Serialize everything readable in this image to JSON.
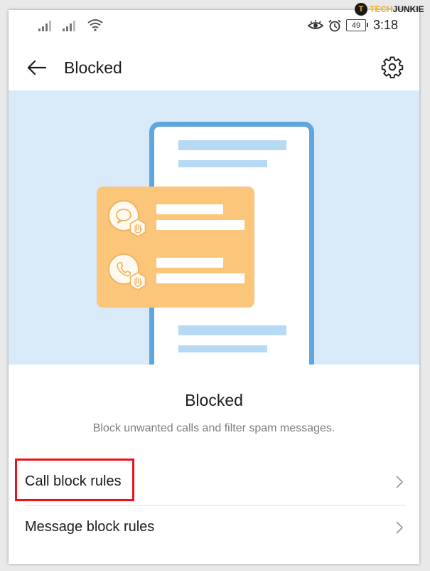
{
  "watermark": {
    "logo_letter": "T",
    "brand_part1": "TECH",
    "brand_part2": "JUNKIE"
  },
  "status_bar": {
    "battery_level": "49",
    "time": "3:18",
    "signal_bars": 2
  },
  "app_bar": {
    "title": "Blocked",
    "back_icon": "arrow-left-icon",
    "settings_icon": "gear-icon"
  },
  "illustration": {
    "background": "#d8e9f7",
    "device_frame": "#5fa5de",
    "card_color": "#fbc57a"
  },
  "content": {
    "heading": "Blocked",
    "subtext": "Block unwanted calls and filter spam messages."
  },
  "list": [
    {
      "label": "Call block rules",
      "highlighted": true
    },
    {
      "label": "Message block rules",
      "highlighted": false
    }
  ],
  "colors": {
    "highlight": "#e8141c",
    "text": "#1b1b1b",
    "secondary_text": "#7d7d7d"
  }
}
